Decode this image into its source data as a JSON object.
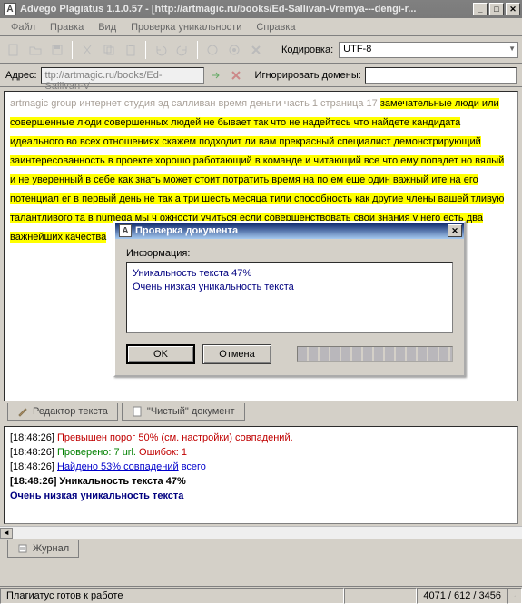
{
  "window": {
    "title": "Advego Plagiatus 1.1.0.57 - [http://artmagic.ru/books/Ed-Sallivan-Vremya---dengi-r..."
  },
  "menu": {
    "file": "Файл",
    "edit": "Правка",
    "view": "Вид",
    "check": "Проверка уникальности",
    "help": "Справка"
  },
  "toolbar": {
    "encoding_label": "Кодировка:",
    "encoding_value": "UTF-8"
  },
  "address": {
    "label": "Адрес:",
    "value": "ttp://artmagic.ru/books/Ed-Sallivan-V",
    "ignore_label": "Игнорировать домены:",
    "ignore_value": ""
  },
  "document": {
    "plain_lead": "artmagic group интернет студия эд салливан время деньги часть 1 страница 17 ",
    "highlighted": "замечательные люди или совершенные люди совершенных людей не бывает так что не надейтесь что найдете кандидата идеального во всех отношениях скажем подходит ли вам прекрасный специалист демонстрирующий заинтересованность в проекте хорошо работающий в команде и читающий все что ему попадет но вялый и не уверенный в себе как знать может стоит потратить время на по ем еще один важный ите на его потенциал ег в первый день не так а три шесть месяца тили способность как другие члены вашей тливую талантливого та в numega мы ч ожности учиться если совершенствовать свои знания у него есть два важнейших качества"
  },
  "tabs": {
    "editor": "Редактор текста",
    "clean": "\"Чистый\" документ"
  },
  "log": {
    "l1_ts": "[18:48:26]",
    "l1_text": "Превышен порог 50% (см. настройки) совпадений.",
    "l2_ts": "[18:48:26]",
    "l2_checked": "Проверено: 7 url.",
    "l2_errors": "Ошибок: 1",
    "l3_ts": "[18:48:26]",
    "l3_link": "Найдено 53% совпадений",
    "l3_tail": "всего",
    "l4_ts": "[18:48:26]",
    "l4_text": "Уникальность текста 47%",
    "l5_text": "Очень низкая уникальность текста"
  },
  "journal": {
    "label": "Журнал"
  },
  "status": {
    "text": "Плагиатус готов к работе",
    "counts": "4071 /   612 /   3456"
  },
  "dialog": {
    "title": "Проверка документа",
    "info_label": "Информация:",
    "line1": "Уникальность текста 47%",
    "line2": "Очень низкая уникальность текста",
    "ok": "OK",
    "cancel": "Отмена"
  }
}
